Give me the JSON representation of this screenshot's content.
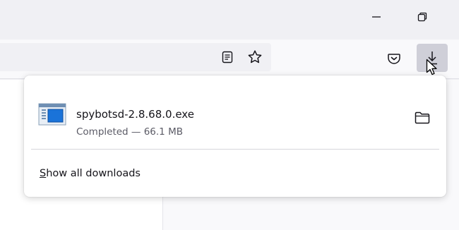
{
  "window_controls": {
    "minimize": "minimize",
    "restore": "restore"
  },
  "toolbar": {
    "icons": [
      "reader-view-icon",
      "bookmark-star-icon",
      "pocket-icon",
      "downloads-arrow-icon"
    ]
  },
  "downloads_panel": {
    "item": {
      "file_name": "spybotsd-2.8.68.0.exe",
      "status": "Completed — 66.1 MB",
      "icon": "exe-file-icon",
      "action_icon": "folder-icon"
    },
    "show_all": {
      "access_key": "S",
      "rest": "how all downloads"
    }
  },
  "colors": {
    "panel_bg": "#ffffff",
    "toolbar_bg": "#f9f9fb",
    "titlebar_bg": "#f0f0f4",
    "downloads_button_active": "#cfcfd8",
    "file_icon_blue": "#1a73d9"
  }
}
